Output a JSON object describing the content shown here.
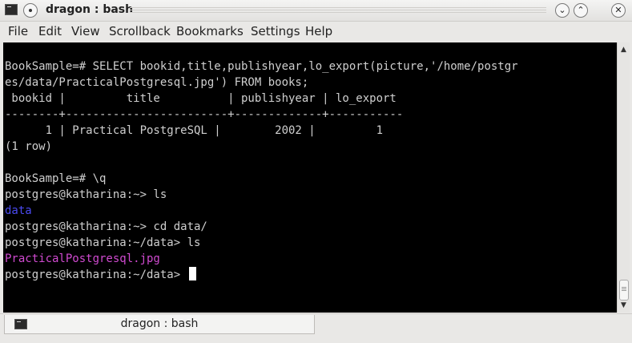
{
  "window": {
    "title": "dragon : bash"
  },
  "menu": [
    "File",
    "Edit",
    "View",
    "Scrollback",
    "Bookmarks",
    "Settings",
    "Help"
  ],
  "terminal": {
    "lines": [
      {
        "text": "",
        "color": "default"
      },
      {
        "text": "BookSample=# SELECT bookid,title,publishyear,lo_export(picture,'/home/postgr",
        "color": "default"
      },
      {
        "text": "es/data/PracticalPostgresql.jpg') FROM books;",
        "color": "default"
      },
      {
        "text": " bookid |         title          | publishyear | lo_export",
        "color": "default"
      },
      {
        "text": "--------+------------------------+-------------+-----------",
        "color": "default"
      },
      {
        "text": "      1 | Practical PostgreSQL |        2002 |         1",
        "color": "default"
      },
      {
        "text": "(1 row)",
        "color": "default"
      },
      {
        "text": "",
        "color": "default"
      },
      {
        "text": "BookSample=# \\q",
        "color": "default"
      },
      {
        "text": "postgres@katharina:~> ls",
        "color": "default"
      },
      {
        "text": "data",
        "color": "blue"
      },
      {
        "text": "postgres@katharina:~> cd data/",
        "color": "default"
      },
      {
        "text": "postgres@katharina:~/data> ls",
        "color": "default"
      },
      {
        "text": "PracticalPostgresql.jpg",
        "color": "magenta"
      },
      {
        "text": "postgres@katharina:~/data> ",
        "color": "default",
        "cursor": true
      }
    ]
  },
  "tabs": [
    {
      "label": "dragon : bash",
      "icon": "terminal-icon"
    }
  ],
  "colors": {
    "background": "#000000",
    "text": "#cfcfcf",
    "directory": "#4a4af0",
    "image_file": "#d04ad0"
  }
}
